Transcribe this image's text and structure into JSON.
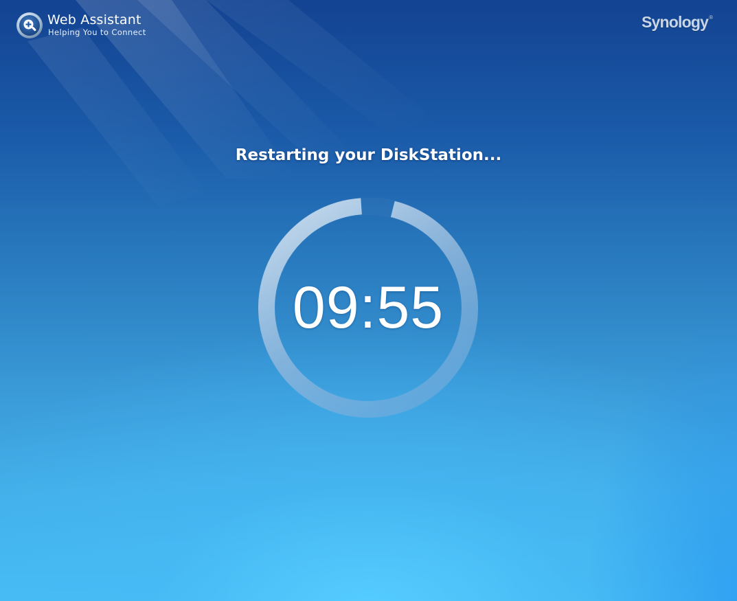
{
  "header": {
    "app_title": "Web Assistant",
    "app_subtitle": "Helping You to Connect",
    "brand": "Synology",
    "brand_mark": "®",
    "logo_icon": "magnifier-plus-icon"
  },
  "status": {
    "title": "Restarting your DiskStation..."
  },
  "countdown": {
    "time": "09:55",
    "progress_fraction": 0.95
  },
  "colors": {
    "background_top": "#134392",
    "background_bottom": "#47bdf4",
    "ring_track": "#7fb0dc",
    "ring_highlight": "#c8dcef",
    "text": "#ffffff",
    "brand": "#c9d6e6"
  }
}
